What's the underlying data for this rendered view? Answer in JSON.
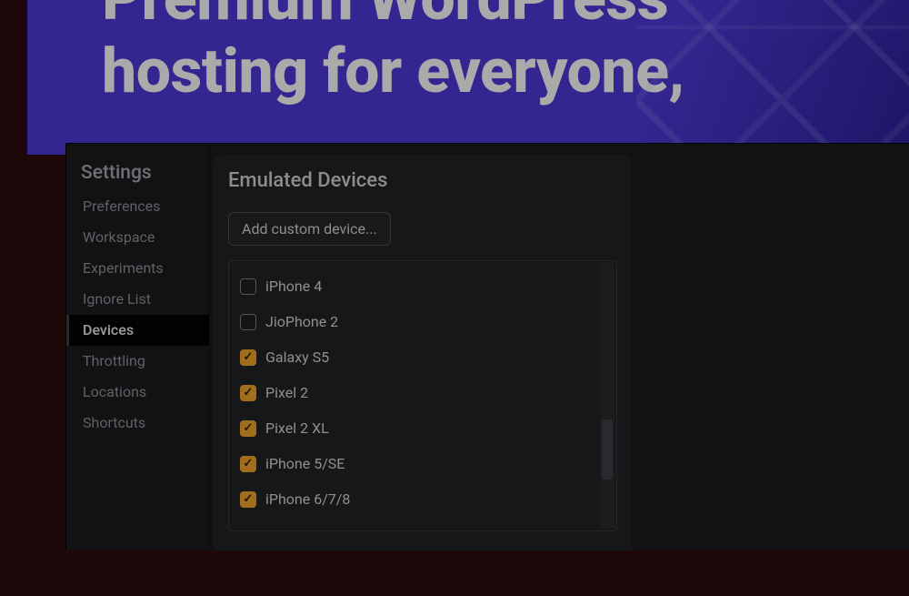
{
  "banner": {
    "headline": "Premium WordPress\nhosting for everyone,"
  },
  "settings": {
    "heading": "Settings",
    "items": [
      {
        "label": "Preferences",
        "active": false
      },
      {
        "label": "Workspace",
        "active": false
      },
      {
        "label": "Experiments",
        "active": false
      },
      {
        "label": "Ignore List",
        "active": false
      },
      {
        "label": "Devices",
        "active": true
      },
      {
        "label": "Throttling",
        "active": false
      },
      {
        "label": "Locations",
        "active": false
      },
      {
        "label": "Shortcuts",
        "active": false
      }
    ]
  },
  "devices_panel": {
    "title": "Emulated Devices",
    "add_button_label": "Add custom device...",
    "devices": [
      {
        "label": "iPhone 4",
        "checked": false
      },
      {
        "label": "JioPhone 2",
        "checked": false
      },
      {
        "label": "Galaxy S5",
        "checked": true
      },
      {
        "label": "Pixel 2",
        "checked": true
      },
      {
        "label": "Pixel 2 XL",
        "checked": true
      },
      {
        "label": "iPhone 5/SE",
        "checked": true
      },
      {
        "label": "iPhone 6/7/8",
        "checked": true
      }
    ]
  },
  "glyphs": {
    "check": "✓"
  }
}
